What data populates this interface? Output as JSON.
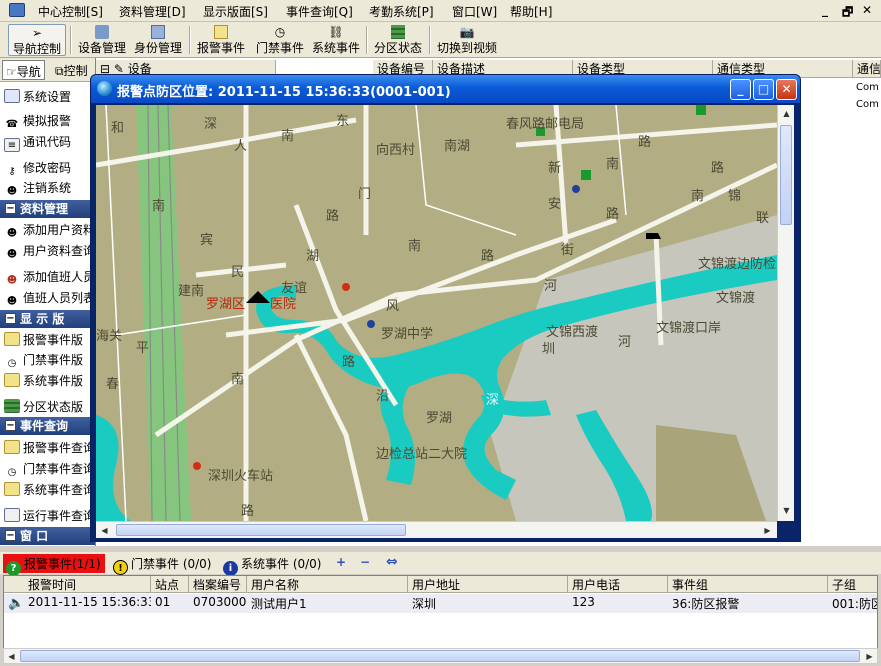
{
  "menubar": {
    "items": [
      "中心控制[S]",
      "资料管理[D]",
      "显示版面[S]",
      "事件查询[Q]",
      "考勤系统[P]",
      "窗口[W]",
      "帮助[H]"
    ],
    "window_controls": [
      "_",
      "🗗",
      "✕"
    ]
  },
  "toolbar": {
    "buttons": [
      {
        "label": "导航控制",
        "icon": "compass-icon"
      },
      {
        "label": "设备管理",
        "icon": "devices-icon"
      },
      {
        "label": "身份管理",
        "icon": "id-card-icon"
      },
      {
        "label": "报警事件",
        "icon": "alarm-doc-icon"
      },
      {
        "label": "门禁事件",
        "icon": "clock-icon"
      },
      {
        "label": "系统事件",
        "icon": "network-icon"
      },
      {
        "label": "分区状态",
        "icon": "stack-icon"
      },
      {
        "label": "切换到视频",
        "icon": "camera-icon"
      }
    ]
  },
  "sidebar": {
    "tabs": [
      "导航",
      "控制"
    ],
    "items": [
      {
        "label": "系统设置",
        "type": "item"
      },
      {
        "label": "模拟报警",
        "type": "item"
      },
      {
        "label": "通讯代码",
        "type": "item"
      },
      {
        "label": "修改密码",
        "type": "item"
      },
      {
        "label": "注销系统",
        "type": "item"
      },
      {
        "label": "资料管理",
        "type": "header"
      },
      {
        "label": "添加用户资料",
        "type": "item"
      },
      {
        "label": "用户资料查询",
        "type": "item"
      },
      {
        "label": "添加值班人员",
        "type": "item"
      },
      {
        "label": "值班人员列表",
        "type": "item"
      },
      {
        "label": "显 示 版",
        "type": "header"
      },
      {
        "label": "报警事件版",
        "type": "item"
      },
      {
        "label": "门禁事件版",
        "type": "item"
      },
      {
        "label": "系统事件版",
        "type": "item"
      },
      {
        "label": "分区状态版",
        "type": "item"
      },
      {
        "label": "事件查询",
        "type": "header"
      },
      {
        "label": "报警事件查询",
        "type": "item"
      },
      {
        "label": "门禁事件查询",
        "type": "item"
      },
      {
        "label": "系统事件查询",
        "type": "item"
      },
      {
        "label": "运行事件查询",
        "type": "item"
      },
      {
        "label": "窗 口",
        "type": "header"
      }
    ]
  },
  "device_table": {
    "columns": [
      "设备",
      "设备编号",
      "设备描述",
      "设备类型",
      "通信类型",
      "通信"
    ],
    "rows": [
      [
        "Com"
      ],
      [
        "Com"
      ]
    ]
  },
  "map_dialog": {
    "title": "报警点防区位置: 2011-11-15 15:36:33(0001-001)",
    "buttons": [
      "_",
      "□",
      "✕"
    ],
    "labels": [
      "和",
      "深",
      "人",
      "南",
      "东",
      "向西村",
      "南湖",
      "春风路邮电局",
      "路",
      "南",
      "新",
      "路",
      "安",
      "路",
      "门",
      "路",
      "南",
      "南",
      "锦",
      "联",
      "宾",
      "湖",
      "民",
      "南",
      "路",
      "街",
      "建南",
      "友谊",
      "河",
      "文锦渡边防检",
      "罗湖区",
      "医院",
      "风",
      "文锦渡",
      "海关",
      "罗湖中学",
      "文锦西渡",
      "文锦渡口岸",
      "平",
      "圳",
      "河",
      "路",
      "春",
      "南",
      "沿",
      "深",
      "罗湖",
      "边检总站二大院",
      "深圳火车站",
      "路"
    ]
  },
  "events": {
    "tabs": [
      {
        "label": "报警事件(1/1)",
        "icon": "alarm-icon"
      },
      {
        "label": "门禁事件 (0/0)",
        "icon": "warning-icon"
      },
      {
        "label": "系统事件 (0/0)",
        "icon": "info-icon"
      }
    ],
    "toolbar_symbols": [
      "+",
      "−",
      "⇔"
    ],
    "columns": [
      "报警时间",
      "站点",
      "档案编号",
      "用户名称",
      "用户地址",
      "用户电话",
      "事件组",
      "子组"
    ],
    "rows": [
      [
        "2011-11-15 15:36:33",
        "01",
        "07030001",
        "测试用户1",
        "深圳",
        "123",
        "36:防区报警",
        "001:防区"
      ]
    ]
  },
  "colors": {
    "title_bar": "#0a5bd6",
    "alarm_tab": "#e81010",
    "sidebar_header": "#22407a",
    "map_land": "#b2ad83",
    "map_water": "#19cbc0",
    "map_rail": "#7fc57a",
    "map_urban": "#c8c8c0"
  }
}
